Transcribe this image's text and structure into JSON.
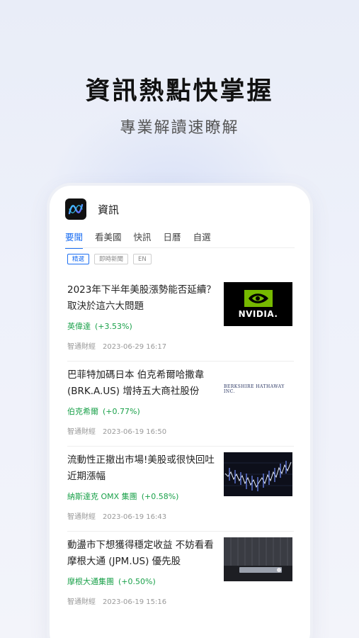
{
  "hero": {
    "title": "資訊熱點快掌握",
    "subtitle": "專業解讀速瞭解"
  },
  "app": {
    "title": "資訊",
    "logo_icon": "app-logo-wave-icon"
  },
  "tabs": [
    {
      "label": "要聞",
      "active": true
    },
    {
      "label": "看美國",
      "active": false
    },
    {
      "label": "快訊",
      "active": false
    },
    {
      "label": "日曆",
      "active": false
    },
    {
      "label": "自選",
      "active": false
    }
  ],
  "filters": [
    {
      "label": "精選",
      "active": true
    },
    {
      "label": "即時新聞",
      "active": false
    },
    {
      "label": "EN",
      "active": false
    }
  ],
  "news": [
    {
      "title": "2023年下半年美股漲勢能否延續？取決於這六大問題",
      "stock": "英偉達",
      "change": "(+3.53%)",
      "source": "智通財經",
      "date": "2023-06-29 16:17",
      "thumb_text": "NVIDIA."
    },
    {
      "title": "巴菲特加碼日本 伯克希爾哈撒韋(BRK.A.US) 增持五大商社股份",
      "stock": "伯克希爾",
      "change": "(+0.77%)",
      "source": "智通財經",
      "date": "2023-06-19 16:50",
      "thumb_text": "BERKSHIRE HATHAWAY INC."
    },
    {
      "title": "流動性正撤出市場!美股或很快回吐近期漲幅",
      "stock": "納斯達克 OMX 集團",
      "change": "(+0.58%)",
      "source": "智通財經",
      "date": "2023-06-19 16:43",
      "thumb_text": ""
    },
    {
      "title": "動盪市下想獲得穩定收益 不妨看看摩根大通 (JPM.US) 優先股",
      "stock": "摩根大通集團",
      "change": "(+0.50%)",
      "source": "智通財經",
      "date": "2023-06-19 15:16",
      "thumb_text": ""
    }
  ],
  "colors": {
    "accent": "#1d6ff2",
    "positive": "#1aa14a",
    "meta": "#999999"
  }
}
